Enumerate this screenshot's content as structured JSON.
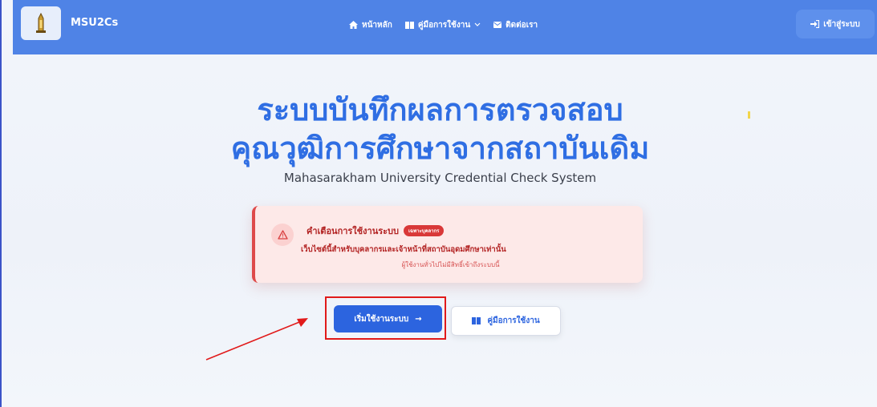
{
  "navbar": {
    "brand": "MSU2Cs",
    "items": [
      {
        "icon": "home-icon",
        "label": "หน้าหลัก"
      },
      {
        "icon": "book-icon",
        "label": "คู่มือการใช้งาน"
      },
      {
        "icon": "mail-icon",
        "label": "ติดต่อเรา"
      }
    ],
    "login_label": "เข้าสู่ระบบ"
  },
  "hero": {
    "title_line1": "ระบบบันทึกผลการตรวจสอบ",
    "title_line2": "คุณวุฒิการศึกษาจากสถาบันเดิม",
    "subtitle": "Mahasarakham University Credential Check System"
  },
  "warning": {
    "title": "คำเตือนการใช้งานระบบ",
    "badge": "เฉพาะบุคลากร",
    "message": "เว็บไซต์นี้สำหรับบุคลากรและเจ้าหน้าที่สถาบันอุดมศึกษาเท่านั้น",
    "submessage": "ผู้ใช้งานทั่วไปไม่มีสิทธิ์เข้าถึงระบบนี้"
  },
  "actions": {
    "start_label": "เริ่มใช้งานระบบ",
    "start_arrow": "→",
    "manual_label": "คู่มือการใช้งาน"
  },
  "colors": {
    "navbar": "#4f83e6",
    "title": "#2f6ee3",
    "primary_button": "#2c64df",
    "warning_accent": "#de4a4a",
    "annotation": "#e11a1a"
  }
}
